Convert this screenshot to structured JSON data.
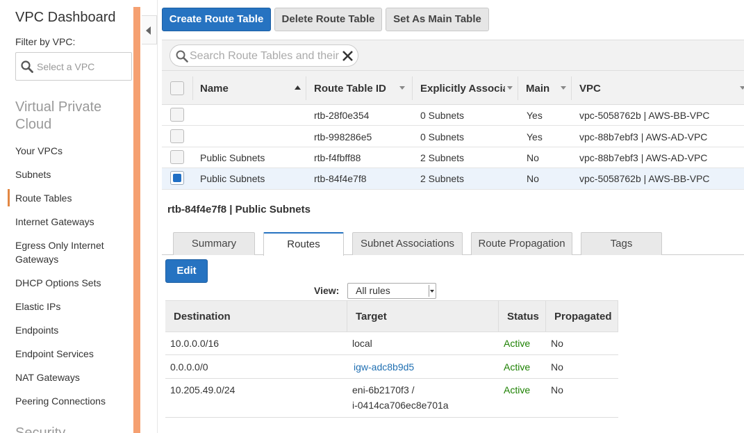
{
  "sidebar": {
    "title": "VPC Dashboard",
    "filter_label": "Filter by VPC:",
    "filter_placeholder": "Select a VPC",
    "section_title": "Virtual Private Cloud",
    "items": [
      {
        "label": "Your VPCs"
      },
      {
        "label": "Subnets"
      },
      {
        "label": "Route Tables",
        "active": true
      },
      {
        "label": "Internet Gateways"
      },
      {
        "label": "Egress Only Internet Gateways"
      },
      {
        "label": "DHCP Options Sets"
      },
      {
        "label": "Elastic IPs"
      },
      {
        "label": "Endpoints"
      },
      {
        "label": "Endpoint Services"
      },
      {
        "label": "NAT Gateways"
      },
      {
        "label": "Peering Connections"
      }
    ],
    "next_section_partial": "Security"
  },
  "toolbar": {
    "create_label": "Create Route Table",
    "delete_label": "Delete Route Table",
    "set_main_label": "Set As Main Table"
  },
  "search": {
    "placeholder": "Search Route Tables and their properties"
  },
  "table": {
    "columns": [
      "Name",
      "Route Table ID",
      "Explicitly Associated With",
      "Main",
      "VPC"
    ],
    "rows": [
      {
        "name": "",
        "id": "rtb-28f0e354",
        "assoc": "0 Subnets",
        "main": "Yes",
        "vpc": "vpc-5058762b | AWS-BB-VPC",
        "selected": false
      },
      {
        "name": "",
        "id": "rtb-998286e5",
        "assoc": "0 Subnets",
        "main": "Yes",
        "vpc": "vpc-88b7ebf3 | AWS-AD-VPC",
        "selected": false
      },
      {
        "name": "Public Subnets",
        "id": "rtb-f4fbff88",
        "assoc": "2 Subnets",
        "main": "No",
        "vpc": "vpc-88b7ebf3 | AWS-AD-VPC",
        "selected": false
      },
      {
        "name": "Public Subnets",
        "id": "rtb-84f4e7f8",
        "assoc": "2 Subnets",
        "main": "No",
        "vpc": "vpc-5058762b | AWS-BB-VPC",
        "selected": true
      }
    ]
  },
  "detail": {
    "title": "rtb-84f4e7f8 | Public Subnets",
    "tabs": [
      "Summary",
      "Routes",
      "Subnet Associations",
      "Route Propagation",
      "Tags"
    ],
    "active_tab": "Routes",
    "edit_label": "Edit",
    "view_label": "View:",
    "view_value": "All rules",
    "routes_columns": [
      "Destination",
      "Target",
      "Status",
      "Propagated"
    ],
    "routes": [
      {
        "destination": "10.0.0.0/16",
        "target": "local",
        "target_line2": "",
        "status": "Active",
        "propagated": "No"
      },
      {
        "destination": "0.0.0.0/0",
        "target": "igw-adc8b9d5",
        "target_line2": "",
        "status": "Active",
        "propagated": "No"
      },
      {
        "destination": "10.205.49.0/24",
        "target": "eni-6b2170f3 /",
        "target_line2": "i-0414ca706ec8e701a",
        "status": "Active",
        "propagated": "No"
      }
    ]
  },
  "colors": {
    "primary": "#2673c1",
    "accent": "#f5a071",
    "status_active": "#1d8102",
    "link": "#1f6fb2"
  }
}
